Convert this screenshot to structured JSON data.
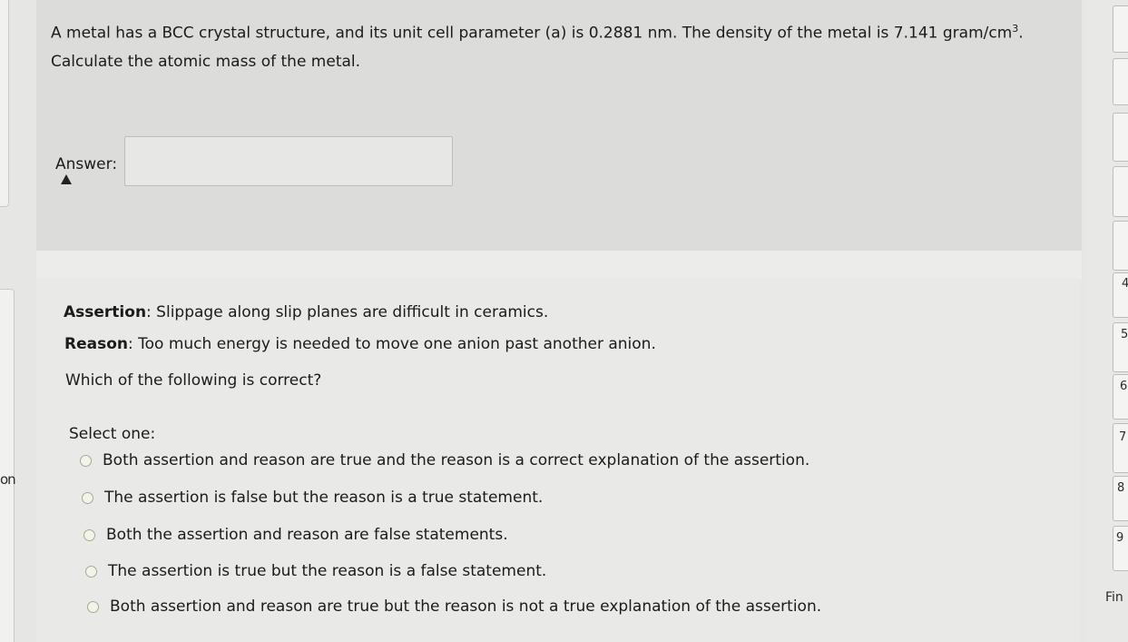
{
  "sidebar": {
    "fragment_text": "on"
  },
  "question1": {
    "text_before_unit": "A metal has a BCC crystal structure, and its unit cell parameter (a) is 0.2881 nm. The density of the metal is 7.141 gram/cm",
    "unit_exponent": "3",
    "text_after_unit": ". Calculate the atomic mass of the metal.",
    "answer_label": "Answer:",
    "answer_value": ""
  },
  "question2": {
    "assertion_label": "Assertion",
    "assertion_text": ": Slippage along slip planes are difficult in ceramics.",
    "reason_label": "Reason",
    "reason_text": ": Too much energy is needed to move one anion past another anion.",
    "prompt": "Which of the following is correct?",
    "select_label": "Select one:",
    "options": [
      "Both assertion and reason are true and the reason is a correct explanation of the assertion.",
      "The assertion is false but the reason is a true statement.",
      "Both the assertion and reason are false statements.",
      "The assertion is true but the reason is a false statement.",
      "Both assertion and reason are true but the reason is not a true explanation of the assertion."
    ]
  },
  "navigation": {
    "items": [
      "4",
      "5",
      "6",
      "7",
      "8",
      "9"
    ],
    "finish_label": "Fin"
  }
}
